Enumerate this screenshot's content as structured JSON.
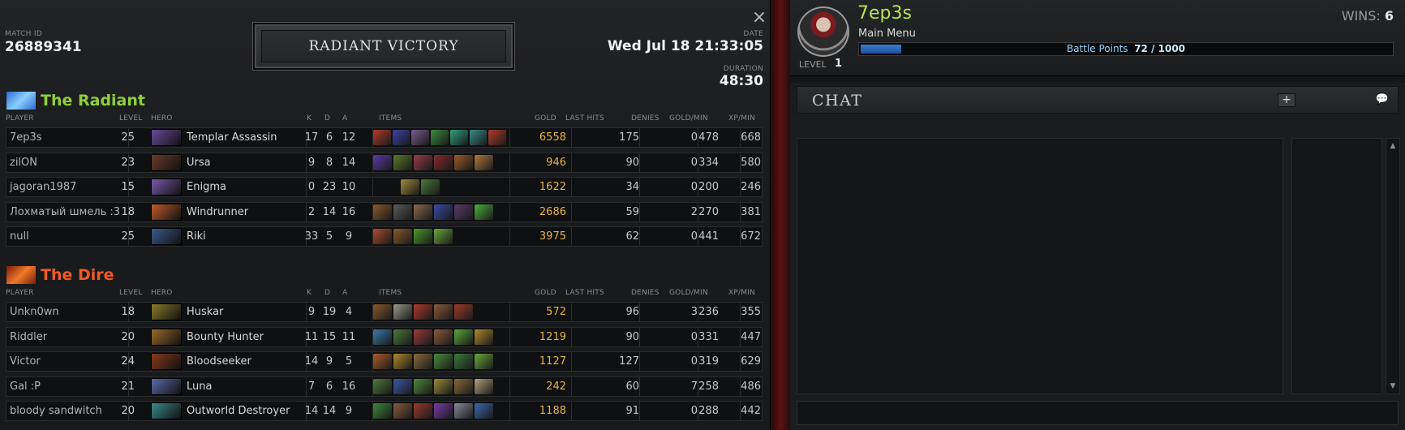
{
  "match": {
    "id_label": "MATCH ID",
    "id": "26889341",
    "date_label": "DATE",
    "date": "Wed Jul 18 21:33:05",
    "duration_label": "DURATION",
    "duration": "48:30",
    "result": "RADIANT VICTORY",
    "close_icon": "×"
  },
  "columns": {
    "player": "PLAYER",
    "level": "LEVEL",
    "hero": "HERO",
    "k": "K",
    "d": "D",
    "a": "A",
    "items": "ITEMS",
    "gold": "GOLD",
    "last_hits": "LAST HITS",
    "denies": "DENIES",
    "gpm": "GOLD/MIN",
    "xpm": "XP/MIN"
  },
  "colors": {
    "radiant": "#8fd03a",
    "dire": "#f05a23",
    "gold": "#e7b43e",
    "accent_green": "#b6e35a"
  },
  "radiant": {
    "name": "The Radiant",
    "players": [
      {
        "player": "7ep3s",
        "level": "25",
        "hero": "Templar Assassin",
        "k": "17",
        "d": "6",
        "a": "12",
        "items": [
          "#b23b2a",
          "#3a44a8",
          "#7a5a8a",
          "#3c8a3a",
          "#2fa07a",
          "#3a8a8a",
          "#b13a2a"
        ],
        "gold": "6558",
        "lh": "175",
        "denies": "0",
        "gpm": "478",
        "xpm": "668",
        "portrait": "#6a4a9a"
      },
      {
        "player": "zilON",
        "level": "23",
        "hero": "Ursa",
        "k": "9",
        "d": "8",
        "a": "14",
        "items": [
          "#5a3aa8",
          "#5a7a2a",
          "#9a3a4a",
          "#8a2a2a",
          "#9a5a2a",
          "#b07a3a"
        ],
        "gold": "946",
        "lh": "90",
        "denies": "0",
        "gpm": "334",
        "xpm": "580",
        "portrait": "#6a3a2a"
      },
      {
        "player": "jagoran1987",
        "level": "15",
        "hero": "Enigma",
        "k": "0",
        "d": "23",
        "a": "10",
        "items": [
          "#a08a3a",
          "#4a7a3a"
        ],
        "gold": "1622",
        "lh": "34",
        "denies": "0",
        "gpm": "200",
        "xpm": "246",
        "portrait": "#7a5aaa"
      },
      {
        "player": "Лохматый шмель :3",
        "level": "18",
        "hero": "Windrunner",
        "k": "2",
        "d": "14",
        "a": "16",
        "items": [
          "#8a5a2a",
          "#5a5a5a",
          "#8a6a4a",
          "#3a4aa8",
          "#5a3a6a",
          "#4ab03a"
        ],
        "gold": "2686",
        "lh": "59",
        "denies": "2",
        "gpm": "270",
        "xpm": "381",
        "portrait": "#c05a2a"
      },
      {
        "player": "null",
        "level": "25",
        "hero": "Riki",
        "k": "33",
        "d": "5",
        "a": "9",
        "items": [
          "#b04a2a",
          "#8a5a2a",
          "#4a9a2a",
          "#6aa83a"
        ],
        "gold": "3975",
        "lh": "62",
        "denies": "0",
        "gpm": "441",
        "xpm": "672",
        "portrait": "#3a5a8a"
      }
    ]
  },
  "dire": {
    "name": "The Dire",
    "players": [
      {
        "player": "Unkn0wn",
        "level": "18",
        "hero": "Huskar",
        "k": "9",
        "d": "19",
        "a": "4",
        "items": [
          "#8a5a2a",
          "#9a9a8a",
          "#b03a2a",
          "#8a5a3a",
          "#a03a2a"
        ],
        "gold": "572",
        "lh": "96",
        "denies": "3",
        "gpm": "236",
        "xpm": "355",
        "portrait": "#8a7a2a"
      },
      {
        "player": "Riddler",
        "level": "20",
        "hero": "Bounty Hunter",
        "k": "11",
        "d": "15",
        "a": "11",
        "items": [
          "#3a7aa8",
          "#4a7a3a",
          "#9a3a3a",
          "#8a5a3a",
          "#5aa83a",
          "#b08a2a"
        ],
        "gold": "1219",
        "lh": "90",
        "denies": "0",
        "gpm": "331",
        "xpm": "447",
        "portrait": "#9a6a2a"
      },
      {
        "player": "Victor",
        "level": "24",
        "hero": "Bloodseeker",
        "k": "14",
        "d": "9",
        "a": "5",
        "items": [
          "#b05a2a",
          "#b08a2a",
          "#8a6a3a",
          "#4a8a3a",
          "#3a7a3a",
          "#6aa83a"
        ],
        "gold": "1127",
        "lh": "127",
        "denies": "0",
        "gpm": "319",
        "xpm": "629",
        "portrait": "#8a3a1a"
      },
      {
        "player": "Gal :P",
        "level": "21",
        "hero": "Luna",
        "k": "7",
        "d": "6",
        "a": "16",
        "items": [
          "#4a7a3a",
          "#3a5aa8",
          "#4a8a3a",
          "#9a8a3a",
          "#8a6a3a",
          "#b0a07a"
        ],
        "gold": "242",
        "lh": "60",
        "denies": "7",
        "gpm": "258",
        "xpm": "486",
        "portrait": "#5a6aa8"
      },
      {
        "player": "bloody sandwitch",
        "level": "20",
        "hero": "Outworld Destroyer",
        "k": "14",
        "d": "14",
        "a": "9",
        "items": [
          "#3a8a3a",
          "#8a5a3a",
          "#9a3a2a",
          "#7a3aa8",
          "#8a8a9a",
          "#3a6ab0"
        ],
        "gold": "1188",
        "lh": "91",
        "denies": "0",
        "gpm": "288",
        "xpm": "442",
        "portrait": "#3a8a8a"
      }
    ]
  },
  "profile": {
    "name": "7ep3s",
    "status": "Main Menu",
    "wins_label": "WINS:",
    "wins": "6",
    "bp_label": "Battle Points",
    "bp_value": "72 / 1000",
    "bp_fraction": 0.072,
    "level_label": "LEVEL",
    "level": "1"
  },
  "chat": {
    "title": "CHAT",
    "add_icon": "+",
    "bubble_icon": "💬",
    "scroll_up": "▲",
    "scroll_down": "▼"
  }
}
